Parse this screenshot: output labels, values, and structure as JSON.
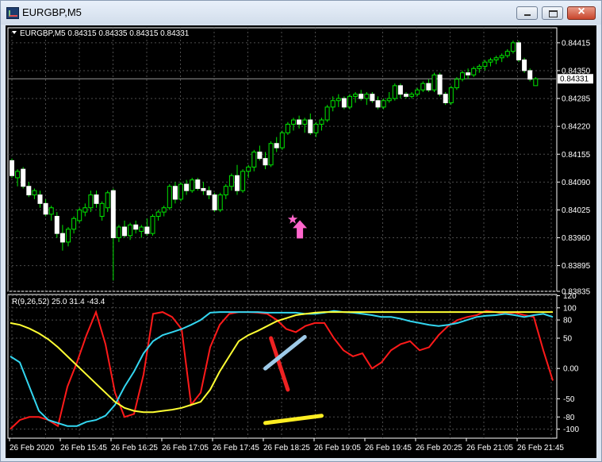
{
  "window": {
    "title": "EURGBP,M5"
  },
  "chart_data": [
    {
      "type": "candlestick",
      "symbol_header": "EURGBP,M5  0.84315 0.84335 0.84315 0.84331",
      "current_price": 0.84331,
      "current_price_label": "0.84331",
      "ylim": [
        0.83835,
        0.8445
      ],
      "yticks": [
        0.84415,
        0.8435,
        0.84285,
        0.8422,
        0.84155,
        0.8409,
        0.84025,
        0.8396,
        0.83895,
        0.83835
      ],
      "ytick_labels": [
        "0.84415",
        "0.84350",
        "0.84285",
        "0.84220",
        "0.84155",
        "0.84090",
        "0.84025",
        "0.83960",
        "0.83895",
        "0.83835"
      ],
      "candles": [
        [
          0.8414,
          0.84145,
          0.841,
          0.84105
        ],
        [
          0.841,
          0.8412,
          0.8408,
          0.84115
        ],
        [
          0.8412,
          0.84125,
          0.84075,
          0.8408
        ],
        [
          0.8408,
          0.8409,
          0.84055,
          0.8406
        ],
        [
          0.8406,
          0.84075,
          0.8405,
          0.8407
        ],
        [
          0.8406,
          0.8407,
          0.8403,
          0.8404
        ],
        [
          0.8404,
          0.8405,
          0.8401,
          0.84015
        ],
        [
          0.84015,
          0.84035,
          0.84,
          0.8403
        ],
        [
          0.8401,
          0.8402,
          0.8396,
          0.8397
        ],
        [
          0.8397,
          0.8399,
          0.8393,
          0.8395
        ],
        [
          0.8395,
          0.83985,
          0.8394,
          0.8398
        ],
        [
          0.8398,
          0.8401,
          0.8397,
          0.84005
        ],
        [
          0.84,
          0.8403,
          0.83995,
          0.84025
        ],
        [
          0.8402,
          0.8404,
          0.8401,
          0.8403
        ],
        [
          0.8403,
          0.8407,
          0.8402,
          0.8406
        ],
        [
          0.8406,
          0.8407,
          0.8403,
          0.8404
        ],
        [
          0.8401,
          0.84045,
          0.84,
          0.8404
        ],
        [
          0.8403,
          0.8407,
          0.8402,
          0.84065
        ],
        [
          0.8407,
          0.84075,
          0.8386,
          0.8396
        ],
        [
          0.8396,
          0.8399,
          0.8395,
          0.83985
        ],
        [
          0.83985,
          0.84,
          0.8396,
          0.83965
        ],
        [
          0.83965,
          0.83995,
          0.83955,
          0.8399
        ],
        [
          0.8399,
          0.84,
          0.8397,
          0.8398
        ],
        [
          0.83975,
          0.8399,
          0.8396,
          0.83985
        ],
        [
          0.83985,
          0.84005,
          0.83965,
          0.8397
        ],
        [
          0.8397,
          0.84015,
          0.83965,
          0.8401
        ],
        [
          0.8401,
          0.84025,
          0.84,
          0.8402
        ],
        [
          0.8402,
          0.84035,
          0.8401,
          0.8403
        ],
        [
          0.8403,
          0.84085,
          0.84025,
          0.8408
        ],
        [
          0.8408,
          0.8409,
          0.8404,
          0.8405
        ],
        [
          0.8405,
          0.8409,
          0.84045,
          0.84085
        ],
        [
          0.84085,
          0.84095,
          0.8406,
          0.8407
        ],
        [
          0.8407,
          0.841,
          0.84065,
          0.84095
        ],
        [
          0.84095,
          0.841,
          0.8407,
          0.84075
        ],
        [
          0.84075,
          0.8409,
          0.8406,
          0.8407
        ],
        [
          0.8407,
          0.8408,
          0.8405,
          0.8406
        ],
        [
          0.8406,
          0.84065,
          0.8402,
          0.84025
        ],
        [
          0.84025,
          0.84065,
          0.8402,
          0.8406
        ],
        [
          0.8406,
          0.84085,
          0.8405,
          0.8408
        ],
        [
          0.8408,
          0.8411,
          0.8407,
          0.84105
        ],
        [
          0.84105,
          0.8413,
          0.8406,
          0.8407
        ],
        [
          0.8407,
          0.8412,
          0.84065,
          0.84115
        ],
        [
          0.84115,
          0.8413,
          0.841,
          0.84125
        ],
        [
          0.84125,
          0.84165,
          0.84115,
          0.8416
        ],
        [
          0.8416,
          0.84175,
          0.8414,
          0.84145
        ],
        [
          0.84145,
          0.8416,
          0.8412,
          0.8413
        ],
        [
          0.8413,
          0.84185,
          0.84125,
          0.8418
        ],
        [
          0.8418,
          0.84195,
          0.8416,
          0.8417
        ],
        [
          0.8417,
          0.8421,
          0.84165,
          0.84205
        ],
        [
          0.84205,
          0.8423,
          0.842,
          0.84225
        ],
        [
          0.84225,
          0.8424,
          0.8421,
          0.84235
        ],
        [
          0.84235,
          0.84245,
          0.84215,
          0.84225
        ],
        [
          0.84225,
          0.8424,
          0.84205,
          0.84235
        ],
        [
          0.84235,
          0.8425,
          0.842,
          0.84205
        ],
        [
          0.84205,
          0.8423,
          0.84195,
          0.84225
        ],
        [
          0.84225,
          0.8424,
          0.8421,
          0.84235
        ],
        [
          0.84235,
          0.8427,
          0.8423,
          0.84265
        ],
        [
          0.84265,
          0.8429,
          0.84255,
          0.8428
        ],
        [
          0.8428,
          0.84295,
          0.84265,
          0.84285
        ],
        [
          0.84285,
          0.8429,
          0.8426,
          0.84265
        ],
        [
          0.84265,
          0.84295,
          0.8426,
          0.8429
        ],
        [
          0.8429,
          0.843,
          0.84275,
          0.84295
        ],
        [
          0.84295,
          0.84305,
          0.8428,
          0.84285
        ],
        [
          0.84285,
          0.843,
          0.8427,
          0.84295
        ],
        [
          0.84295,
          0.843,
          0.84275,
          0.8428
        ],
        [
          0.8428,
          0.8429,
          0.8426,
          0.84265
        ],
        [
          0.84265,
          0.84285,
          0.8426,
          0.8428
        ],
        [
          0.8428,
          0.843,
          0.84275,
          0.84285
        ],
        [
          0.84285,
          0.8432,
          0.8428,
          0.84315
        ],
        [
          0.84315,
          0.8432,
          0.84285,
          0.84295
        ],
        [
          0.84295,
          0.843,
          0.84285,
          0.8429
        ],
        [
          0.8429,
          0.843,
          0.84285,
          0.84295
        ],
        [
          0.84295,
          0.8431,
          0.8429,
          0.84305
        ],
        [
          0.84305,
          0.84325,
          0.843,
          0.8432
        ],
        [
          0.8432,
          0.8433,
          0.843,
          0.84305
        ],
        [
          0.84305,
          0.84345,
          0.843,
          0.8434
        ],
        [
          0.8434,
          0.84345,
          0.8429,
          0.84295
        ],
        [
          0.84295,
          0.843,
          0.8427,
          0.84275
        ],
        [
          0.84275,
          0.84315,
          0.8427,
          0.8431
        ],
        [
          0.8431,
          0.84335,
          0.84305,
          0.8433
        ],
        [
          0.8433,
          0.8435,
          0.84325,
          0.84345
        ],
        [
          0.84345,
          0.84355,
          0.8433,
          0.8434
        ],
        [
          0.8434,
          0.8436,
          0.84335,
          0.84355
        ],
        [
          0.84355,
          0.84365,
          0.84345,
          0.8436
        ],
        [
          0.8436,
          0.84375,
          0.8435,
          0.8437
        ],
        [
          0.8437,
          0.8438,
          0.8436,
          0.84375
        ],
        [
          0.84375,
          0.84385,
          0.84365,
          0.8438
        ],
        [
          0.8438,
          0.8439,
          0.8437,
          0.84385
        ],
        [
          0.84385,
          0.844,
          0.8438,
          0.84395
        ],
        [
          0.84395,
          0.8442,
          0.8439,
          0.84415
        ],
        [
          0.84415,
          0.8442,
          0.8437,
          0.84375
        ],
        [
          0.84375,
          0.8438,
          0.84345,
          0.8435
        ],
        [
          0.8435,
          0.84355,
          0.84325,
          0.8433
        ],
        [
          0.84315,
          0.84335,
          0.84315,
          0.84331
        ]
      ]
    },
    {
      "type": "line",
      "title": "R(9,26,52) 25.0 31.4 -43.4",
      "ylim": [
        -115,
        122
      ],
      "yticks": [
        120,
        100,
        80,
        50,
        0,
        -50,
        -80,
        -100
      ],
      "ytick_labels": [
        "120",
        "100",
        "80",
        "50",
        "0.00",
        "-50",
        "-80",
        "-100"
      ],
      "series": [
        {
          "color": "#ff1a1a",
          "values": [
            -100,
            -85,
            -80,
            -80,
            -85,
            -95,
            -30,
            10,
            55,
            93,
            40,
            -40,
            -80,
            -75,
            -10,
            90,
            93,
            85,
            65,
            -60,
            -40,
            35,
            72,
            90,
            93,
            93,
            92,
            90,
            80,
            65,
            60,
            70,
            75,
            75,
            50,
            30,
            20,
            25,
            0,
            10,
            30,
            40,
            45,
            30,
            35,
            55,
            70,
            80,
            85,
            88,
            95,
            93,
            90,
            92,
            88,
            85,
            30,
            -20,
            -60
          ]
        },
        {
          "color": "#33d6f0",
          "values": [
            20,
            10,
            -30,
            -70,
            -85,
            -90,
            -95,
            -95,
            -88,
            -85,
            -78,
            -60,
            -30,
            -5,
            25,
            45,
            55,
            60,
            65,
            72,
            80,
            92,
            93,
            93,
            93,
            93,
            93,
            92,
            92,
            92,
            92,
            90,
            90,
            92,
            95,
            93,
            92,
            90,
            88,
            85,
            85,
            82,
            78,
            75,
            72,
            70,
            72,
            75,
            80,
            85,
            87,
            88,
            90,
            88,
            85,
            88,
            90,
            85,
            75
          ]
        },
        {
          "color": "#ffff33",
          "values": [
            75,
            72,
            66,
            58,
            48,
            35,
            20,
            5,
            -10,
            -25,
            -40,
            -55,
            -65,
            -70,
            -72,
            -72,
            -70,
            -68,
            -65,
            -60,
            -55,
            -35,
            -5,
            20,
            45,
            55,
            62,
            70,
            78,
            83,
            88,
            90,
            92,
            93,
            93,
            93,
            93,
            93,
            93,
            93,
            93,
            93,
            93,
            93,
            93,
            93,
            93,
            93,
            93,
            93,
            93,
            93,
            93,
            93,
            93,
            93,
            93,
            93,
            90
          ]
        }
      ],
      "annotations": {
        "star_marker": {
          "candle": 51,
          "color": "#ff66cc"
        },
        "arrow_marker": {
          "candle": 51,
          "color": "#ff66cc"
        },
        "lines": [
          {
            "color": "#ee2222",
            "from": [
              46,
              50
            ],
            "to": [
              49,
              -35
            ]
          },
          {
            "color": "#9ecae8",
            "from": [
              45,
              0
            ],
            "to": [
              52,
              52
            ]
          },
          {
            "color": "#ffee22",
            "from": [
              45,
              -90
            ],
            "to": [
              55,
              -78
            ]
          }
        ]
      }
    }
  ],
  "time_labels": [
    "26 Feb 2020",
    "26 Feb 15:45",
    "26 Feb 16:25",
    "26 Feb 17:05",
    "26 Feb 17:45",
    "26 Feb 18:25",
    "26 Feb 19:05",
    "26 Feb 19:45",
    "26 Feb 20:25",
    "26 Feb 21:05",
    "26 Feb 21:45"
  ]
}
